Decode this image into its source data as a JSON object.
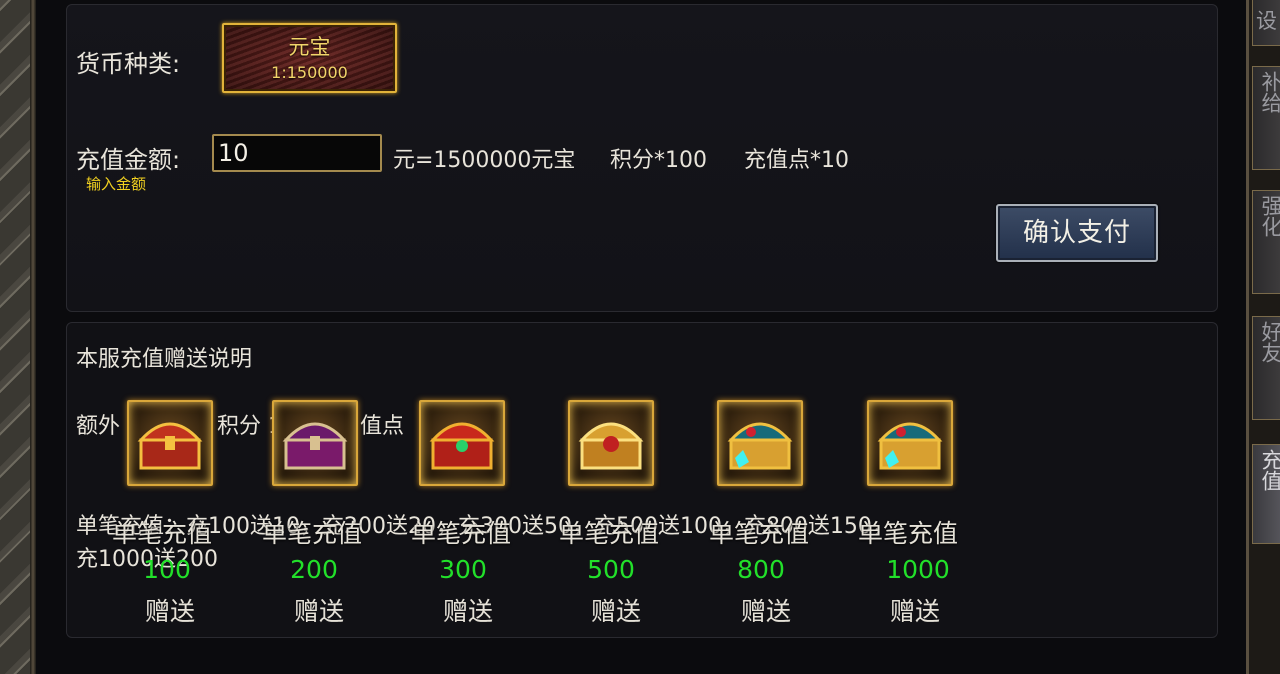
{
  "right_tabs": [
    {
      "label": "设",
      "active": false
    },
    {
      "label": "补给",
      "active": false
    },
    {
      "label": "强化",
      "active": false
    },
    {
      "label": "好友",
      "active": false
    },
    {
      "label": "充值",
      "active": true
    }
  ],
  "recharge": {
    "currency_label": "货币种类:",
    "currency_option": {
      "name": "元宝",
      "rate": "1:150000"
    },
    "amount_label": "充值金额:",
    "amount_value": "10",
    "amount_hint": "输入金额",
    "conversion_text": "元=1500000元宝",
    "points_text": "积分*100",
    "recharge_points_text": "充值点*10",
    "confirm_label": "确认支付"
  },
  "bonus": {
    "heading": "本服充值赠送说明",
    "extra_text_a": "额外",
    "extra_text_b": "积分 1",
    "extra_text_c": "值点",
    "single_line1": "单笔充值：充100送10，充200送20，充300送50，充500送100，充800送150，",
    "single_line2": "充1000送200",
    "tiers": [
      {
        "title": "单笔充值",
        "amount": "100",
        "gift": "赠送",
        "chest": "red-gold-chest-icon"
      },
      {
        "title": "单笔充值",
        "amount": "200",
        "gift": "赠送",
        "chest": "purple-chest-icon"
      },
      {
        "title": "单笔充值",
        "amount": "300",
        "gift": "赠送",
        "chest": "red-jewel-chest-icon"
      },
      {
        "title": "单笔充值",
        "amount": "500",
        "gift": "赠送",
        "chest": "golden-ornate-chest-icon"
      },
      {
        "title": "单笔充值",
        "amount": "800",
        "gift": "赠送",
        "chest": "teal-gem-chest-icon"
      },
      {
        "title": "单笔充值",
        "amount": "1000",
        "gift": "赠送",
        "chest": "teal-gem-chest-icon"
      }
    ]
  },
  "colors": {
    "gold": "#e2b33a",
    "amount_green": "#22e02a",
    "hint_yellow": "#f0d020"
  }
}
